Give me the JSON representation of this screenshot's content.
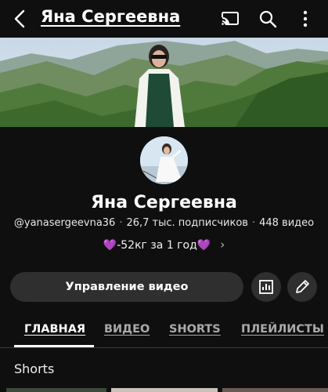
{
  "header": {
    "title": "Яна Сергеевна"
  },
  "channel": {
    "name": "Яна Сергеевна",
    "handle": "@yanasergeevna36",
    "subscribers": "26,7 тыс. подписчиков",
    "videos": "448 видео",
    "separator": "·",
    "bio_heart_left": "💜",
    "bio_text": "-52кг за 1 год",
    "bio_heart_right": "💜",
    "bio_chevron": "›"
  },
  "actions": {
    "manage_label": "Управление видео"
  },
  "tabs": [
    {
      "label": "ГЛАВНАЯ",
      "active": true
    },
    {
      "label": "ВИДЕО",
      "active": false
    },
    {
      "label": "SHORTS",
      "active": false
    },
    {
      "label": "ПЛЕЙЛИСТЫ",
      "active": false
    }
  ],
  "sections": {
    "shorts_title": "Shorts"
  },
  "colors": {
    "background": "#0f0f0f",
    "button_bg": "#2f2f2f",
    "heart": "#b46cf4"
  },
  "icons": [
    "back-arrow-icon",
    "cast-icon",
    "search-icon",
    "more-vert-icon",
    "analytics-icon",
    "edit-pencil-icon"
  ]
}
